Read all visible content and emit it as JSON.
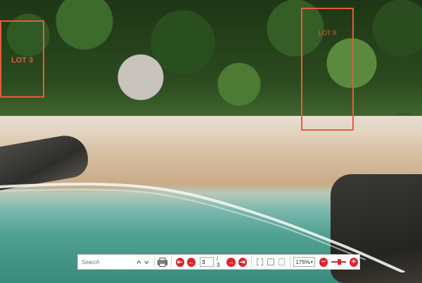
{
  "lots": [
    {
      "label": "LOT 3",
      "color": "#e85a3c"
    },
    {
      "label": "LOT 9",
      "color": "#e85a3c"
    }
  ],
  "toolbar": {
    "search_placeholder": "Search",
    "page_current": "3",
    "page_total": "/ 3",
    "zoom_value": "176%",
    "accent": "#d8262e",
    "icons": {
      "search_up": "chevron-up-icon",
      "search_down": "chevron-down-icon",
      "print": "printer-icon",
      "first": "first-page-icon",
      "prev": "previous-page-icon",
      "next": "next-page-icon",
      "last": "last-page-icon",
      "fit_page": "fit-page-icon",
      "fit_width": "fit-width-icon",
      "single_page": "single-page-icon",
      "zoom_out": "zoom-out-icon",
      "zoom_in": "zoom-in-icon"
    }
  }
}
